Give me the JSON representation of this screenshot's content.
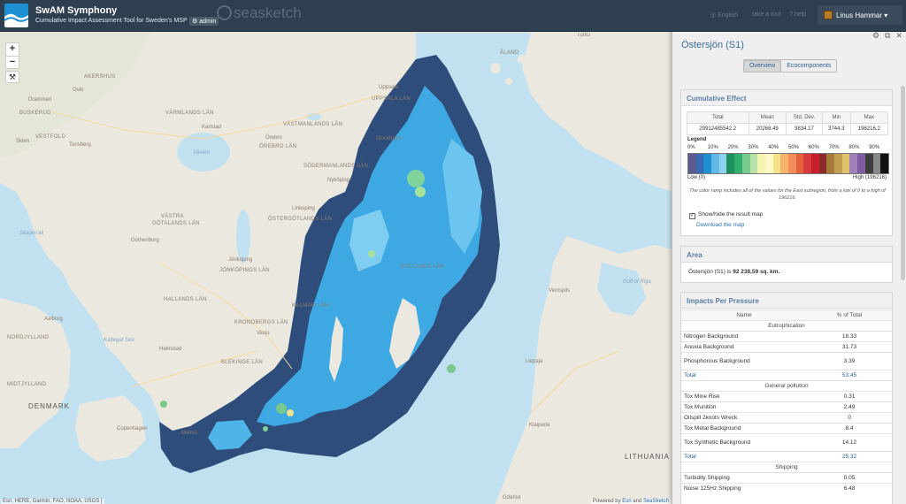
{
  "header": {
    "title": "SwAM Symphony",
    "subtitle": "Cumulative Impact Assessment Tool for Sweden's MSP",
    "admin_label": "admin",
    "brand": "seasketch",
    "lang_link": "English",
    "tour_link": "take a tour",
    "help_link": "help",
    "user_name": "Linus Hammar"
  },
  "map": {
    "zoom_in": "+",
    "zoom_out": "−",
    "tool_glyph": "⚒",
    "attribution_left": "Esri, HERE, Garmin, FAO, NOAA, USGS |",
    "attribution_right_prefix": "Powered by",
    "attribution_right_esri": "Esri",
    "attribution_right_and": "and",
    "attribution_right_seasketch": "SeaSketch",
    "labels": {
      "arkushus": "AKERSHUS",
      "oslo": "Oslo",
      "drammen": "Drammen",
      "buskerud": "BUSKERUD",
      "vestfold": "VESTFOLD",
      "skien": "Skien",
      "tonsberg": "Tonsberg",
      "varmlands": "VÄRMLANDS LÄN",
      "karlstad": "Karlstad",
      "vanern": "Vänern",
      "orebro": "Örebro",
      "orebro_lan": "ÖREBRO LÄN",
      "uppsala": "Uppsala",
      "uppsala_lan": "UPPSALA LÄN",
      "vastmanlands": "VÄSTMANLANDS LÄN",
      "stockholm": "Stockholm",
      "nykoping": "Nyköping",
      "sodermanlands": "SÖDERMANLANDS LÄN",
      "linkoping": "Linkoping",
      "ostergotlands": "ÖSTERGÖTLANDS LÄN",
      "vastra": "VÄSTRA",
      "gotalands": "GÖTALANDS LÄN",
      "gothenburg": "Gothenburg",
      "skagerrak": "Skagerrak",
      "jonkoping": "Jönkoping",
      "jonkoping_lan": "JÖNKÖPINGS LÄN",
      "halland": "HALLANDS LÄN",
      "kronobergs": "KRONOBERGS LÄN",
      "kalmar_lan": "KALMAR LÄN",
      "vaxjo": "Vaxjo",
      "kattegat": "Kattegat Sea",
      "halmstad": "Halmstad",
      "aalborg": "Aalborg",
      "nordjylland": "NORDJYLLAND",
      "midtjylland": "MIDTJYLLAND",
      "denmark": "DENMARK",
      "copenhagen": "Copenhagen",
      "malmo": "Malmo",
      "blekinge": "BLEKINGE LÄN",
      "gotland": "GOTLANDS LÄN",
      "ventspils": "Ventspils",
      "liepaja": "Liepaja",
      "klaipeda": "Klaipeda",
      "lithuania": "LITHUANIA",
      "gulf_riga": "Gulf of Riga",
      "turku": "Turku",
      "aland": "ÅLAND",
      "gdansk": "Gdańsk"
    }
  },
  "panel": {
    "title": "Östersjön (S1)",
    "tool_icons": [
      "gear-icon",
      "popout-icon",
      "close-icon"
    ],
    "tabs": [
      {
        "label": "Overview",
        "active": true
      },
      {
        "label": "Ecocomponents",
        "active": false
      }
    ],
    "cumulative": {
      "heading": "Cumulative Effect",
      "columns": [
        "Total",
        "Mean",
        "Std. Dev.",
        "Min",
        "Max"
      ],
      "values": [
        "29912485542.2",
        "20268.49",
        "9834.17",
        "3744.3",
        "196216.2"
      ],
      "legend_title": "Legend",
      "legend_pcts": [
        "0%",
        "10%",
        "20%",
        "30%",
        "40%",
        "50%",
        "60%",
        "70%",
        "80%",
        "90%"
      ],
      "ramp_colors": [
        "#5b5b8c",
        "#3a6bb4",
        "#1f8fd3",
        "#5fb8e6",
        "#8fd1f0",
        "#1e8e5a",
        "#2fae6e",
        "#79c98e",
        "#b8e3a8",
        "#f4f3b0",
        "#fff8c5",
        "#f3e28a",
        "#f7b46a",
        "#f28d5a",
        "#e5623f",
        "#d63a3a",
        "#c8202a",
        "#8b2a2a",
        "#a87a3a",
        "#c0a050",
        "#e2c36b",
        "#9e7fb8",
        "#7d5ea0",
        "#3d3d3d",
        "#888888",
        "#111111"
      ],
      "low_label": "Low (0)",
      "high_label": "High (196216)",
      "note": "The color ramp includes all of the values for the East subregion, from a low of 0 to a high of 196216.",
      "checkbox_label": "Show/hide the result map",
      "download_label": "Download the map"
    },
    "area": {
      "heading": "Area",
      "text_prefix": "Östersjön (S1) is",
      "value": "92 238,59 sq. km."
    },
    "pressures": {
      "heading": "Impacts Per Pressure",
      "col_name": "Name",
      "col_pct": "% of Total",
      "groups": [
        {
          "name": "Eutrophication",
          "rows": [
            {
              "name": "Nitrogen Background",
              "pct": "18.33"
            },
            {
              "name": "Anoxia Background",
              "pct": "31.73"
            },
            {
              "name": "Phosphorous Background",
              "pct": "3.39"
            }
          ],
          "total_label": "Total",
          "total": "53.45"
        },
        {
          "name": "General pollution",
          "rows": [
            {
              "name": "Tox Mine Risk",
              "pct": "0.31"
            },
            {
              "name": "Tox Munition",
              "pct": "2.49"
            },
            {
              "name": "Oilspill 2knots Wreck",
              "pct": "0"
            },
            {
              "name": "Tox Metal Background",
              "pct": "8.4"
            },
            {
              "name": "Tox Synthetic Background",
              "pct": "14.12"
            }
          ],
          "total_label": "Total",
          "total": "25.32"
        },
        {
          "name": "Shipping",
          "rows": [
            {
              "name": "Turbidity Shipping",
              "pct": "0.05"
            },
            {
              "name": "Noise 125Hz Shipping",
              "pct": "6.48"
            }
          ]
        }
      ]
    }
  }
}
